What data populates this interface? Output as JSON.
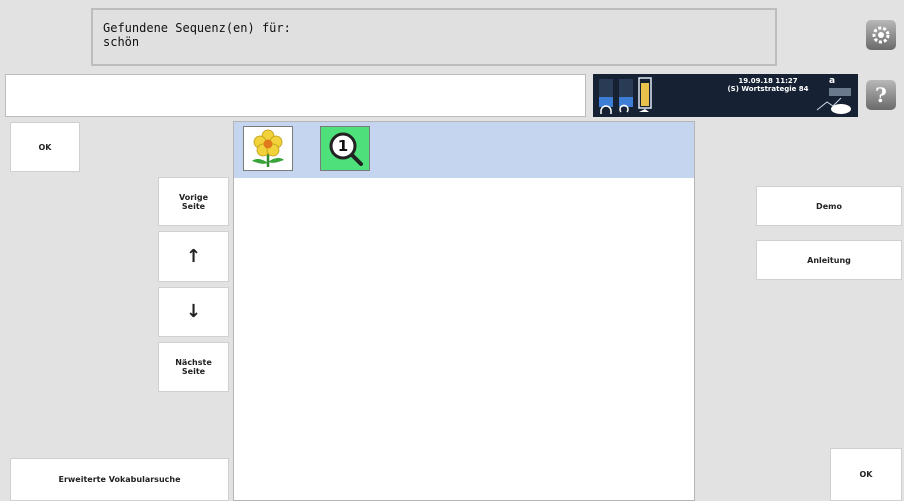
{
  "message": {
    "line1": "Gefundene Sequenz(en) für:",
    "line2": "schön"
  },
  "status": {
    "datetime": "19.09.18 11:27",
    "mode": "(S) Wortstrategie 84",
    "letter": "a"
  },
  "buttons": {
    "ok_top": "OK",
    "prev_page_line1": "Vorige",
    "prev_page_line2": "Seite",
    "up_arrow": "↑",
    "down_arrow": "↓",
    "next_page_line1": "Nächste",
    "next_page_line2": "Seite",
    "extended_search": "Erweiterte Vokabularsuche",
    "demo": "Demo",
    "instructions": "Anleitung",
    "ok_bottom": "OK",
    "help": "?"
  },
  "sequences": [
    {
      "icons": [
        "flower-icon",
        "magnifier-one-icon"
      ],
      "badge": "1"
    }
  ],
  "colors": {
    "background": "#e2e2e2",
    "selected_row": "#c5d5ef",
    "status_bar": "#162234",
    "symbol_green": "#4ee07a"
  }
}
